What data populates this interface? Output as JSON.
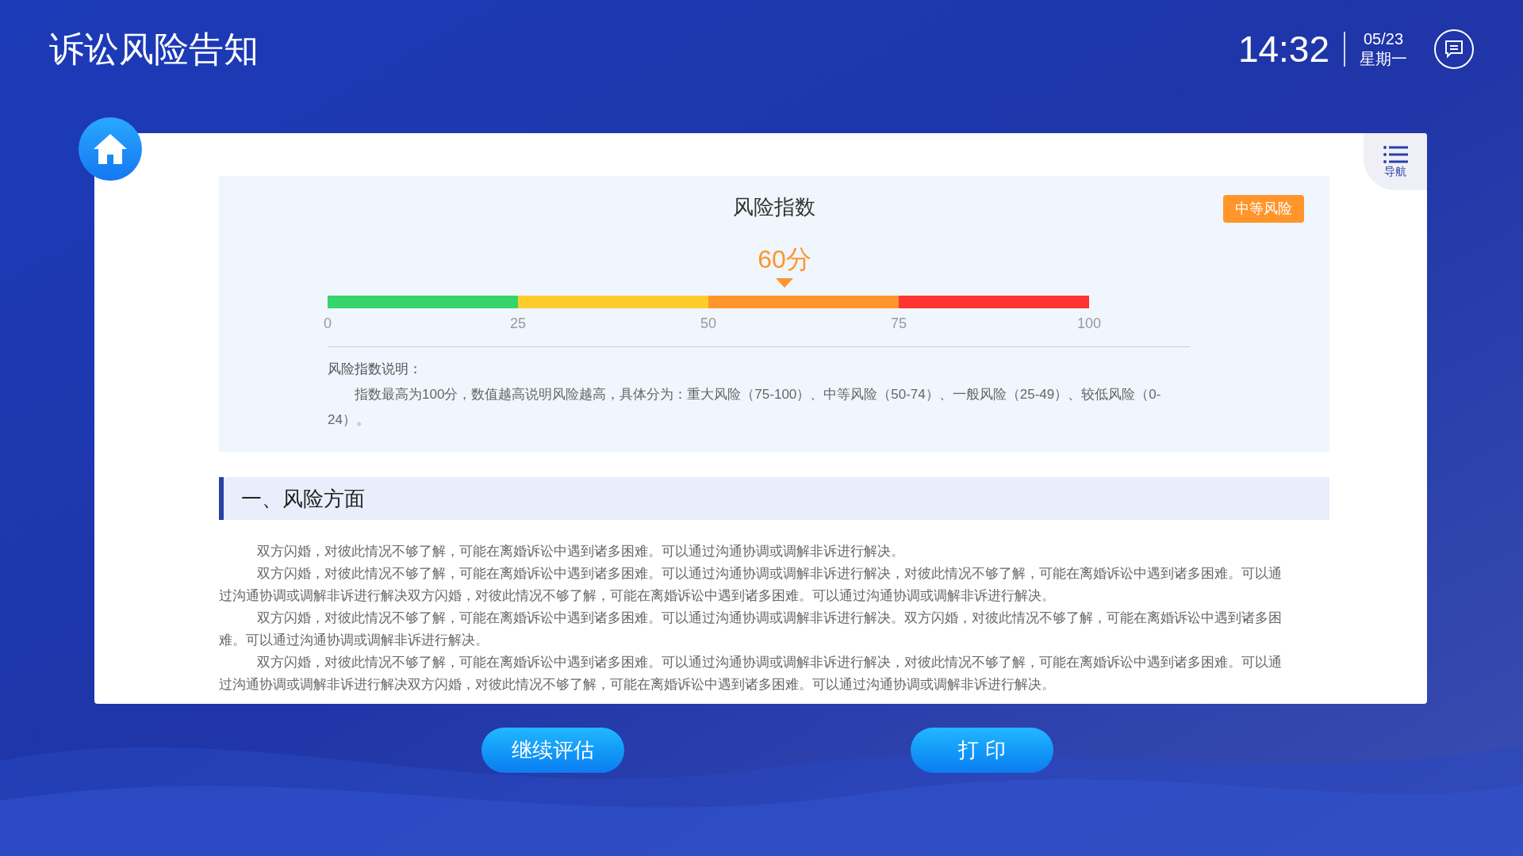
{
  "header": {
    "title": "诉讼风险告知",
    "time": "14:32",
    "date": "05/23",
    "weekday": "星期一"
  },
  "nav": {
    "label": "导航"
  },
  "risk_index": {
    "title": "风险指数",
    "badge": "中等风险",
    "score": "60分",
    "level": 0.6,
    "segments": [
      {
        "color": "#36d46a"
      },
      {
        "color": "#ffcc2e"
      },
      {
        "color": "#ff952b"
      },
      {
        "color": "#ff3330"
      }
    ],
    "ticks": [
      "0",
      "25",
      "50",
      "75",
      "100"
    ],
    "note_title": "风险指数说明：",
    "note": "指数最高为100分，数值越高说明风险越高，具体分为：重大风险（75-100）、中等风险（50-74）、一般风险（25-49）、较低风险（0-24）。"
  },
  "section": {
    "heading": "一、风险方面",
    "paragraphs": [
      "双方闪婚，对彼此情况不够了解，可能在离婚诉讼中遇到诸多困难。可以通过沟通协调或调解非诉进行解决。",
      "双方闪婚，对彼此情况不够了解，可能在离婚诉讼中遇到诸多困难。可以通过沟通协调或调解非诉进行解决，对彼此情况不够了解，可能在离婚诉讼中遇到诸多困难。可以通过沟通协调或调解非诉进行解决双方闪婚，对彼此情况不够了解，可能在离婚诉讼中遇到诸多困难。可以通过沟通协调或调解非诉进行解决。",
      "双方闪婚，对彼此情况不够了解，可能在离婚诉讼中遇到诸多困难。可以通过沟通协调或调解非诉进行解决。双方闪婚，对彼此情况不够了解，可能在离婚诉讼中遇到诸多困难。可以通过沟通协调或调解非诉进行解决。",
      "双方闪婚，对彼此情况不够了解，可能在离婚诉讼中遇到诸多困难。可以通过沟通协调或调解非诉进行解决，对彼此情况不够了解，可能在离婚诉讼中遇到诸多困难。可以通过沟通协调或调解非诉进行解决双方闪婚，对彼此情况不够了解，可能在离婚诉讼中遇到诸多困难。可以通过沟通协调或调解非诉进行解决。"
    ]
  },
  "buttons": [
    "继续评估",
    "打 印"
  ]
}
